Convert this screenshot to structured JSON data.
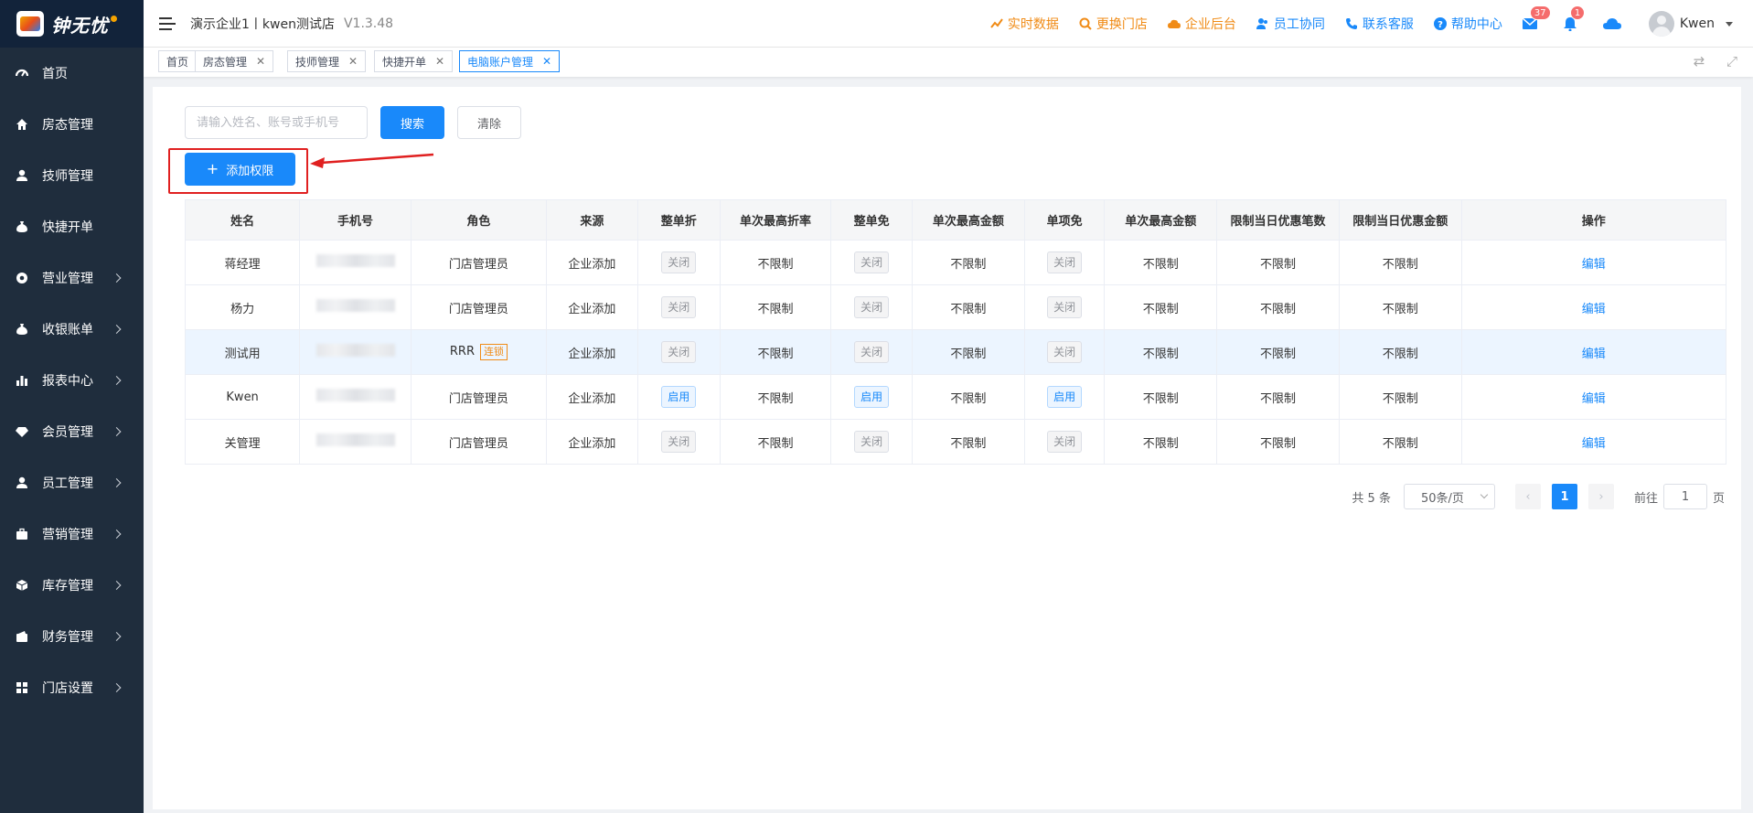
{
  "app": {
    "logo_text": "钟无忧"
  },
  "sidebar": {
    "items": [
      {
        "label": "首页",
        "icon": "dashboard-icon",
        "has_arrow": false
      },
      {
        "label": "房态管理",
        "icon": "home-icon",
        "has_arrow": false
      },
      {
        "label": "技师管理",
        "icon": "person-icon",
        "has_arrow": false
      },
      {
        "label": "快捷开单",
        "icon": "moneybag-icon",
        "has_arrow": false
      },
      {
        "label": "营业管理",
        "icon": "aperture-icon",
        "has_arrow": true
      },
      {
        "label": "收银账单",
        "icon": "moneybag-icon",
        "has_arrow": true
      },
      {
        "label": "报表中心",
        "icon": "bar-chart-icon",
        "has_arrow": true
      },
      {
        "label": "会员管理",
        "icon": "diamond-icon",
        "has_arrow": true
      },
      {
        "label": "员工管理",
        "icon": "person-icon",
        "has_arrow": true
      },
      {
        "label": "营销管理",
        "icon": "briefcase-icon",
        "has_arrow": true
      },
      {
        "label": "库存管理",
        "icon": "cube-icon",
        "has_arrow": true
      },
      {
        "label": "财务管理",
        "icon": "wallet-icon",
        "has_arrow": true
      },
      {
        "label": "门店设置",
        "icon": "grid-icon",
        "has_arrow": true
      }
    ]
  },
  "header": {
    "store": "演示企业1丨kwen测试店",
    "version": "V1.3.48",
    "links": [
      {
        "label": "实时数据",
        "icon": "trend-icon",
        "color": "orange"
      },
      {
        "label": "更换门店",
        "icon": "search-icon",
        "color": "orange"
      },
      {
        "label": "企业后台",
        "icon": "cloud-icon",
        "color": "orange"
      },
      {
        "label": "员工协同",
        "icon": "people-icon",
        "color": "blue"
      },
      {
        "label": "联系客服",
        "icon": "phone-icon",
        "color": "blue"
      },
      {
        "label": "帮助中心",
        "icon": "help-icon",
        "color": "blue"
      }
    ],
    "mail_badge": "37",
    "bell_badge": "1",
    "user_name": "Kwen"
  },
  "tabs": [
    {
      "label": "首页",
      "closable": false,
      "active": false
    },
    {
      "label": "房态管理",
      "closable": true,
      "active": false
    },
    {
      "label": "技师管理",
      "closable": true,
      "active": false
    },
    {
      "label": "快捷开单",
      "closable": true,
      "active": false
    },
    {
      "label": "电脑账户管理",
      "closable": true,
      "active": true
    }
  ],
  "toolbar": {
    "search_placeholder": "请输入姓名、账号或手机号",
    "search_label": "搜索",
    "clear_label": "清除",
    "add_label": "添加权限"
  },
  "table": {
    "columns": [
      "姓名",
      "手机号",
      "角色",
      "来源",
      "整单折",
      "单次最高折率",
      "整单免",
      "单次最高金额",
      "单项免",
      "单次最高金额",
      "限制当日优惠笔数",
      "限制当日优惠金额",
      "操作"
    ],
    "rows": [
      {
        "name": "蒋经理",
        "role": "门店管理员",
        "role_tag": "",
        "source": "企业添加",
        "discount": "关闭",
        "discount_on": false,
        "max_rate": "不限制",
        "free_order": "关闭",
        "free_order_on": false,
        "max_amount1": "不限制",
        "free_item": "关闭",
        "free_item_on": false,
        "max_amount2": "不限制",
        "limit_count": "不限制",
        "limit_amount": "不限制",
        "action": "编辑",
        "highlight": false
      },
      {
        "name": "杨力",
        "role": "门店管理员",
        "role_tag": "",
        "source": "企业添加",
        "discount": "关闭",
        "discount_on": false,
        "max_rate": "不限制",
        "free_order": "关闭",
        "free_order_on": false,
        "max_amount1": "不限制",
        "free_item": "关闭",
        "free_item_on": false,
        "max_amount2": "不限制",
        "limit_count": "不限制",
        "limit_amount": "不限制",
        "action": "编辑",
        "highlight": false
      },
      {
        "name": "测试用",
        "role": "RRR",
        "role_tag": "连锁",
        "source": "企业添加",
        "discount": "关闭",
        "discount_on": false,
        "max_rate": "不限制",
        "free_order": "关闭",
        "free_order_on": false,
        "max_amount1": "不限制",
        "free_item": "关闭",
        "free_item_on": false,
        "max_amount2": "不限制",
        "limit_count": "不限制",
        "limit_amount": "不限制",
        "action": "编辑",
        "highlight": true
      },
      {
        "name": "Kwen",
        "role": "门店管理员",
        "role_tag": "",
        "source": "企业添加",
        "discount": "启用",
        "discount_on": true,
        "max_rate": "不限制",
        "free_order": "启用",
        "free_order_on": true,
        "max_amount1": "不限制",
        "free_item": "启用",
        "free_item_on": true,
        "max_amount2": "不限制",
        "limit_count": "不限制",
        "limit_amount": "不限制",
        "action": "编辑",
        "highlight": false
      },
      {
        "name": "关管理",
        "role": "门店管理员",
        "role_tag": "",
        "source": "企业添加",
        "discount": "关闭",
        "discount_on": false,
        "max_rate": "不限制",
        "free_order": "关闭",
        "free_order_on": false,
        "max_amount1": "不限制",
        "free_item": "关闭",
        "free_item_on": false,
        "max_amount2": "不限制",
        "limit_count": "不限制",
        "limit_amount": "不限制",
        "action": "编辑",
        "highlight": false
      }
    ]
  },
  "pagination": {
    "total": "共 5 条",
    "page_size": "50条/页",
    "current": "1",
    "goto_label": "前往",
    "goto_value": "1",
    "page_suffix": "页"
  },
  "colors": {
    "accent": "#1989fa",
    "sidebar_bg": "#1f2d3d",
    "orange": "#f08b16",
    "annotation_red": "#e02020"
  }
}
